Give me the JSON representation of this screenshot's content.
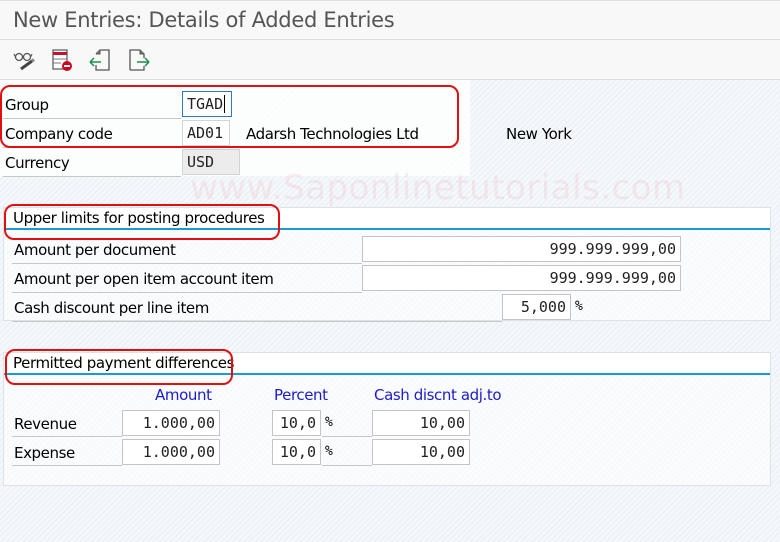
{
  "window": {
    "title": "New Entries: Details of Added Entries"
  },
  "toolbar": {
    "buttons": [
      {
        "icon": "display-change-icon",
        "label": "Display/Change"
      },
      {
        "icon": "delete-icon",
        "label": "Delete"
      },
      {
        "icon": "previous-entry-icon",
        "label": "Previous Entry"
      },
      {
        "icon": "next-entry-icon",
        "label": "Next Entry"
      }
    ]
  },
  "header": {
    "group": {
      "label": "Group",
      "value": "TGAD"
    },
    "company_code": {
      "label": "Company code",
      "value": "AD01",
      "name": "Adarsh Technologies Ltd",
      "city": "New York"
    },
    "currency": {
      "label": "Currency",
      "value": "USD"
    }
  },
  "watermark": "www.Saponlinetutorials.com",
  "upper_limits": {
    "title": "Upper limits for posting procedures",
    "rows": [
      {
        "label": "Amount per document",
        "value": "999.999.999,00"
      },
      {
        "label": "Amount per open item account item",
        "value": "999.999.999,00"
      },
      {
        "label": "Cash discount per line item",
        "value": "5,000",
        "unit": "%"
      }
    ]
  },
  "payment_differences": {
    "title": "Permitted payment differences",
    "columns": {
      "amount": "Amount",
      "percent": "Percent",
      "cash_discount": "Cash discnt adj.to"
    },
    "rows": [
      {
        "label": "Revenue",
        "amount": "1.000,00",
        "percent": "10,0",
        "unit": "%",
        "cash_discount": "10,00"
      },
      {
        "label": "Expense",
        "amount": "1.000,00",
        "percent": "10,0",
        "unit": "%",
        "cash_discount": "10,00"
      }
    ]
  },
  "colors": {
    "accent": "#1a9ad6",
    "highlight": "#e01010",
    "column_header": "#1c1ccc"
  }
}
